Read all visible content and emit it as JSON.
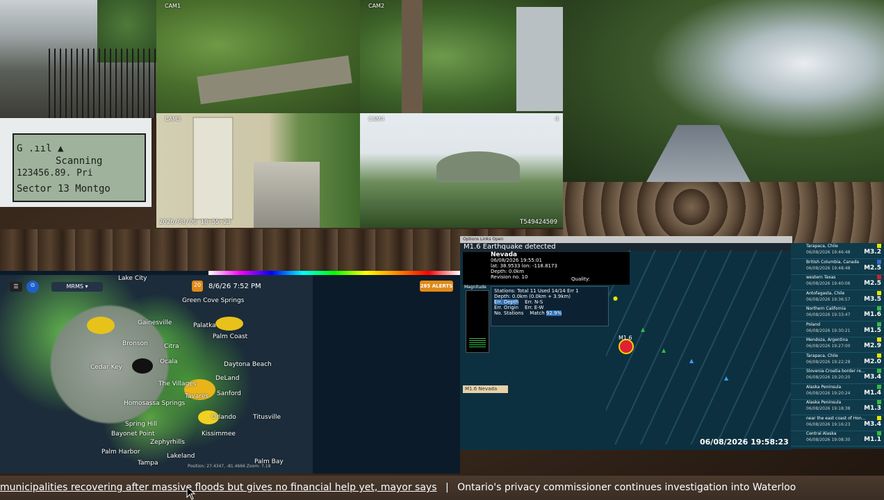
{
  "cameras": {
    "cam1": {
      "label": "CAM1"
    },
    "cam2": {
      "label": "CAM2"
    },
    "cam3": {
      "label": "CAM3",
      "timestamp": "2026/08/06 18:55:23"
    },
    "cam4": {
      "label": "CAM4",
      "corner": "4",
      "stamp": "T549424509"
    }
  },
  "scanner": {
    "line1": "G   .ııl  ▲",
    "line2": "Scanning",
    "line3": "123456.89. Pri",
    "line4": "Sector 13 Montgo"
  },
  "radar": {
    "product": "MRMS",
    "datetime": "8/6/26 7:52 PM",
    "speed": "20",
    "alerts": "285 ALERTS",
    "footer": "Position: 27.4347, -81.4666  Zoom: 7.18",
    "cities": [
      "Lake City",
      "Green Cove Springs",
      "Gainesville",
      "Palatka",
      "Palm Coast",
      "Bronson",
      "Ocala",
      "Citra",
      "Daytona Beach",
      "DeLand",
      "The Villages",
      "Sanford",
      "Tavares",
      "Homosassa Springs",
      "Orlando",
      "Titusville",
      "Spring Hill",
      "Kissimmee",
      "Bayonet Point",
      "Zephyrhills",
      "Palm Harbor",
      "Lakeland",
      "Tampa",
      "Palm Bay",
      "Cedar Key"
    ]
  },
  "quake": {
    "menubar": "Options   Links   Open",
    "title": "M1.6 Earthquake detected",
    "region": "Nevada",
    "datetime": "06/08/2026 19:55:01",
    "latlon": "lat: 38.9533 lon: -118.8173",
    "depth": "Depth: 0.0km",
    "revision": "Revision no. 10",
    "quality": "Quality:",
    "stations": "Stations: Total 11 Used 14/14 Err 1",
    "depth2": "Depth: 0.0km (0.0km + 3.9km)",
    "err_depth": "Err. Depth",
    "err_ns": "Err. N-S",
    "err_origin": "Err. Origin",
    "err_ew": "Err. E-W",
    "no_stations": "No. Stations",
    "match": "Match",
    "match_val": "92.9%",
    "magnitude_label": "Magnitude",
    "place_tag": "M1.6 Nevada",
    "stamp": "06/08/2026 19:58:23",
    "epicenter_label": "M1.6"
  },
  "quake_list": [
    {
      "loc": "Tarapaca, Chile",
      "time": "06/08/2026 19:46:48",
      "mag": "M3.2",
      "dist": "",
      "color": "#e6e600"
    },
    {
      "loc": "British Columbia, Canada",
      "time": "06/08/2026 19:48:48",
      "mag": "M2.5",
      "dist": "",
      "color": "#2f6fd0"
    },
    {
      "loc": "western Texas",
      "time": "06/08/2026 19:40:06",
      "mag": "M2.5",
      "dist": "",
      "color": "#d02020"
    },
    {
      "loc": "Antofagasta, Chile",
      "time": "06/08/2026 19:36:57",
      "mag": "M3.5",
      "dist": "",
      "color": "#e6e600"
    },
    {
      "loc": "Northern California",
      "time": "06/08/2026 19:33:47",
      "mag": "M1.6",
      "dist": "",
      "color": "#2fbf3f"
    },
    {
      "loc": "Poland",
      "time": "06/08/2026 19:30:21",
      "mag": "M1.5",
      "dist": "",
      "color": "#2fbf3f"
    },
    {
      "loc": "Mendoza, Argentina",
      "time": "06/08/2026 19:27:00",
      "mag": "M2.9",
      "dist": "",
      "color": "#e6e600"
    },
    {
      "loc": "Tarapaca, Chile",
      "time": "06/08/2026 19:22:28",
      "mag": "M2.0",
      "dist": "",
      "color": "#e6e600"
    },
    {
      "loc": "Slovenia-Croatia border re...",
      "time": "06/08/2026 19:20:20",
      "mag": "M3.4",
      "dist": "",
      "color": "#2fbf3f"
    },
    {
      "loc": "Alaska Peninsula",
      "time": "06/08/2026 19:20:24",
      "mag": "M1.4",
      "dist": "",
      "color": "#2fbf3f"
    },
    {
      "loc": "Alaska Peninsula",
      "time": "06/08/2026 19:18:38",
      "mag": "M1.3",
      "dist": "",
      "color": "#2fbf3f"
    },
    {
      "loc": "near the east coast of Hon...",
      "time": "06/08/2026 19:16:23",
      "mag": "M3.4",
      "dist": "",
      "color": "#e6e600"
    },
    {
      "loc": "Central Alaska",
      "time": "06/08/2026 19:08:30",
      "mag": "M1.1",
      "dist": "",
      "color": "#2fbf3f"
    }
  ],
  "ticker": {
    "headline1": "municipalities recovering after massive floods but gives no financial help yet, mayor says",
    "separator": "|",
    "headline2": "Ontario's privacy commissioner continues investigation into Waterloo"
  }
}
